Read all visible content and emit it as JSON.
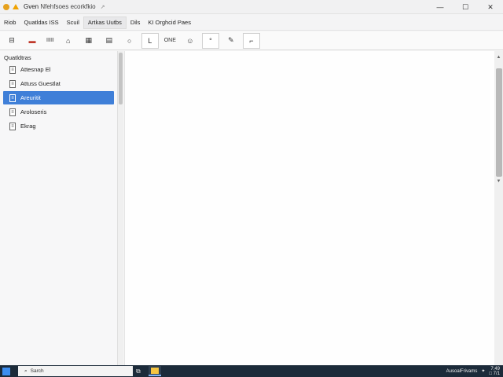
{
  "window": {
    "title": "Gven",
    "title_rest": "Nfehfsoes ecorkfkio",
    "pin": "↗",
    "controls": {
      "minimize": "—",
      "maximize": "☐",
      "close": "✕"
    }
  },
  "menu": [
    "Riob",
    "Quatldas ISS",
    "Scuil",
    "Artkas Uutbs",
    "Dils",
    "KI Orghcid Paes"
  ],
  "toolbar": {
    "tools": [
      {
        "icon": "book-icon",
        "glyph": "⊟"
      },
      {
        "icon": "red-bar-icon",
        "glyph": "▬"
      },
      {
        "icon": "text-tool",
        "glyph": "IIIII"
      },
      {
        "icon": "home-icon",
        "glyph": "⌂"
      },
      {
        "icon": "grid-icon",
        "glyph": "▦"
      },
      {
        "icon": "document-icon",
        "glyph": "▤"
      },
      {
        "icon": "circle-icon",
        "glyph": "○"
      },
      {
        "icon": "letter-l-icon",
        "glyph": "L"
      },
      {
        "icon": "text-label",
        "glyph": "ONE"
      },
      {
        "icon": "smiley-icon",
        "glyph": "☺"
      },
      {
        "icon": "hint-icon",
        "glyph": "°"
      },
      {
        "icon": "pen-icon",
        "glyph": "✎"
      },
      {
        "icon": "curve-icon",
        "glyph": "⌐"
      }
    ]
  },
  "sidebar": {
    "heading": "Quatldtras",
    "items": [
      {
        "label": "Attesnap El",
        "selected": false
      },
      {
        "label": "Attuss Guestlat",
        "selected": false
      },
      {
        "label": "Areuritit",
        "selected": true
      },
      {
        "label": "Aroloseris",
        "selected": false
      },
      {
        "label": "Ekrag",
        "selected": false
      }
    ]
  },
  "taskbar": {
    "search_placeholder": "Sarch",
    "tray_text": "AusoalFrivams",
    "clock_time": "7:49",
    "clock_date": "□ 7/1"
  }
}
